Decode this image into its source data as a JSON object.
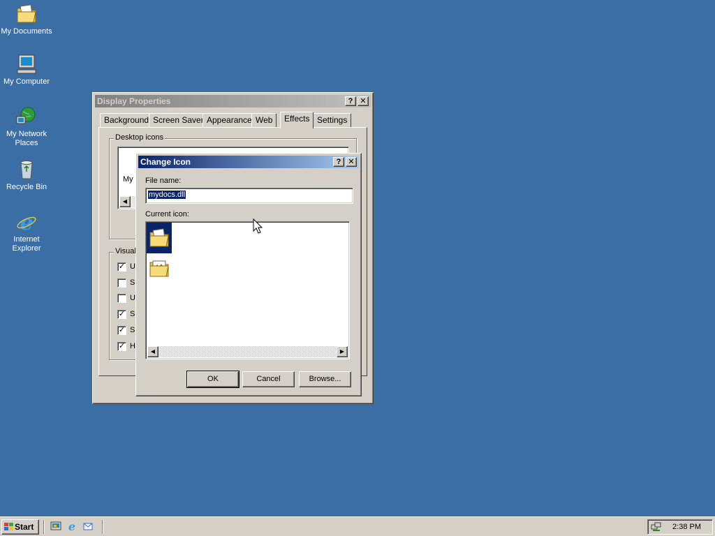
{
  "desktop": {
    "icons": [
      {
        "label": "My Documents"
      },
      {
        "label": "My Computer"
      },
      {
        "label": "My Network Places"
      },
      {
        "label": "Recycle Bin"
      },
      {
        "label": "Internet Explorer"
      }
    ]
  },
  "display_properties": {
    "title": "Display Properties",
    "help_glyph": "?",
    "close_glyph": "✕",
    "tabs": [
      "Background",
      "Screen Saver",
      "Appearance",
      "Web",
      "Effects",
      "Settings"
    ],
    "selected_tab": "Effects",
    "desktop_icons_group": "Desktop icons",
    "desktop_icon_partial_label": "My",
    "visual_group": "Visual",
    "options": [
      {
        "label": "U",
        "checked": true
      },
      {
        "label": "S",
        "checked": false
      },
      {
        "label": "U",
        "checked": false
      },
      {
        "label": "S",
        "checked": true
      },
      {
        "label": "S",
        "checked": true
      },
      {
        "label": "H",
        "checked": true
      }
    ]
  },
  "change_icon": {
    "title": "Change Icon",
    "help_glyph": "?",
    "close_glyph": "✕",
    "file_name_label": "File name:",
    "file_name_value": "mydocs.dll",
    "current_icon_label": "Current icon:",
    "icons": [
      "my-documents-folder-icon",
      "pictures-folder-icon"
    ],
    "ok": "OK",
    "cancel": "Cancel",
    "browse": "Browse..."
  },
  "taskbar": {
    "start": "Start",
    "clock": "2:38 PM"
  },
  "colors": {
    "desktop": "#3a6ea5",
    "face": "#d4d0c8",
    "active_title": "#0a246a",
    "selection": "#0a246a"
  }
}
